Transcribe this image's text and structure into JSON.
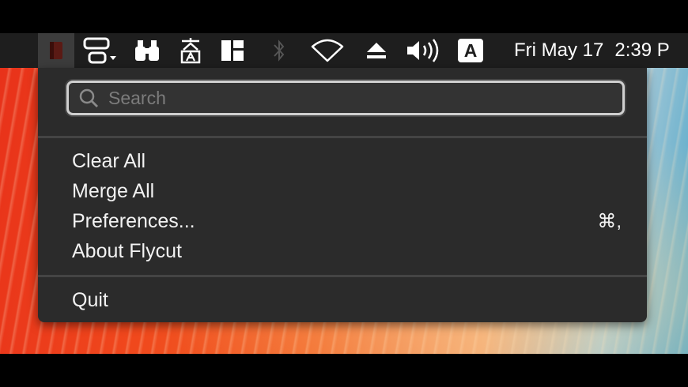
{
  "menubar": {
    "clock": {
      "date": "Fri May 17",
      "time": "2:39 P"
    },
    "input_source_letter": "A",
    "icons": [
      "flycut-icon",
      "mission-control-icon",
      "binoculars-icon",
      "translate-icon",
      "layout-icon",
      "bluetooth-icon",
      "wifi-icon",
      "eject-icon",
      "volume-icon",
      "input-source-icon"
    ]
  },
  "menu": {
    "search": {
      "placeholder": "Search",
      "value": ""
    },
    "items": [
      {
        "label": "Clear All"
      },
      {
        "label": "Merge All"
      },
      {
        "label": "Preferences...",
        "shortcut": "⌘,"
      },
      {
        "label": "About Flycut"
      }
    ],
    "quit": {
      "label": "Quit"
    }
  }
}
